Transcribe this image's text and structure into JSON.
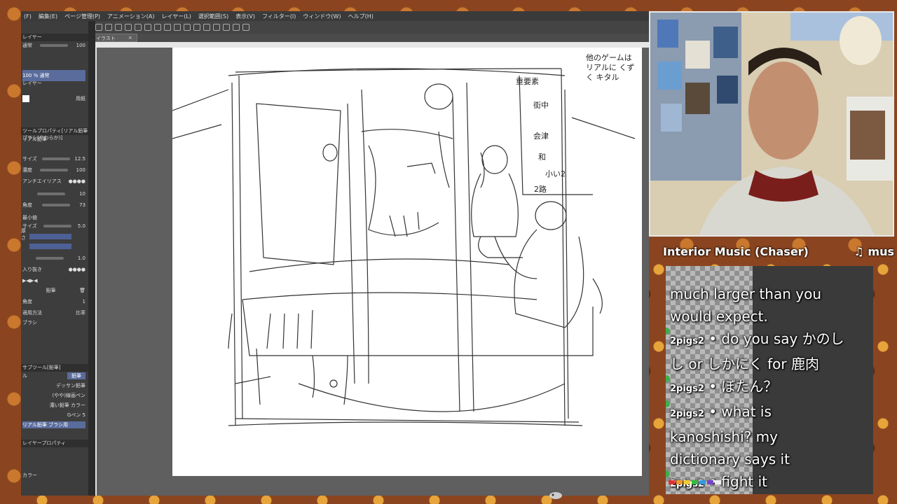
{
  "menu": [
    "(F)",
    "編集(E)",
    "ページ管理(P)",
    "アニメーション(A)",
    "レイヤー(L)",
    "選択範囲(S)",
    "表示(V)",
    "フィルター(I)",
    "ウィンドウ(W)",
    "ヘルプ(H)"
  ],
  "canvas_tab": "イラスト",
  "left_panel": {
    "layer_header": "レイヤー",
    "blend_mode": "通常",
    "opacity": "100",
    "layer1_name": "100 % 通常",
    "layer1_sub": "レイヤー",
    "layer2_name": "用紙",
    "tool_property_header": "ツールプロパティ[リアル鉛筆ブラシ(やわらか)]",
    "tool_name": "リアル鉛筆",
    "brush_size_label": "サイズ",
    "brush_size": "12.5",
    "density_label": "濃度",
    "density": "100",
    "antialias_label": "アンチエイリアス",
    "hardness_val": "10",
    "angle_label": "角度",
    "angle_val": "73",
    "min_label": "最小値",
    "size_label2": "サイズ",
    "size_val2": "5.0",
    "thickness_label": "厚さ",
    "val_a": "1.0",
    "pen_label": "入り抜き",
    "pencil_label": "鉛筆",
    "rotate_label": "角度",
    "rotate_val": "1",
    "method_label": "適用方法",
    "method_val": "比率",
    "brush_label": "ブラシ",
    "sub_tool_header": "サブツール[鉛筆]",
    "subtool_tab1": "鉛筆",
    "subtool_tab2": "ル",
    "brushes": [
      "デッサン鉛筆",
      "(やや)線画ペン",
      "濃い鉛筆 カラー",
      "Gペン 5",
      "リアル鉛筆 ブラシ用"
    ],
    "layer_prop_header": "レイヤープロパティ",
    "color_label": "カラー"
  },
  "sketch_text": {
    "top_right": "他のゲームは リアルに くずく キタル",
    "notes": [
      "重要素",
      "街中",
      "会津",
      "和",
      "小い2",
      "2路"
    ]
  },
  "music": {
    "title": "Interior Music (Chaser)",
    "artist": "♫ mus"
  },
  "chat": [
    {
      "user": "",
      "text": "much larger than you"
    },
    {
      "user": "",
      "text": "would expect."
    },
    {
      "user": "2pigs2",
      "text": "do you say かのし"
    },
    {
      "user": "",
      "text": "し or しかにく for 鹿肉"
    },
    {
      "user": "2pigs2",
      "text": "ぼたん？"
    },
    {
      "user": "2pigs2",
      "text": "what is"
    },
    {
      "user": "",
      "text": "kanoshishi? my"
    },
    {
      "user": "",
      "text": "dictionary says it"
    },
    {
      "user": "2pigs2",
      "text": "fight it"
    }
  ],
  "colors": {
    "accent": "#5a6c9c",
    "background": "#8a4520",
    "chat_badge": "#3fae4a"
  }
}
